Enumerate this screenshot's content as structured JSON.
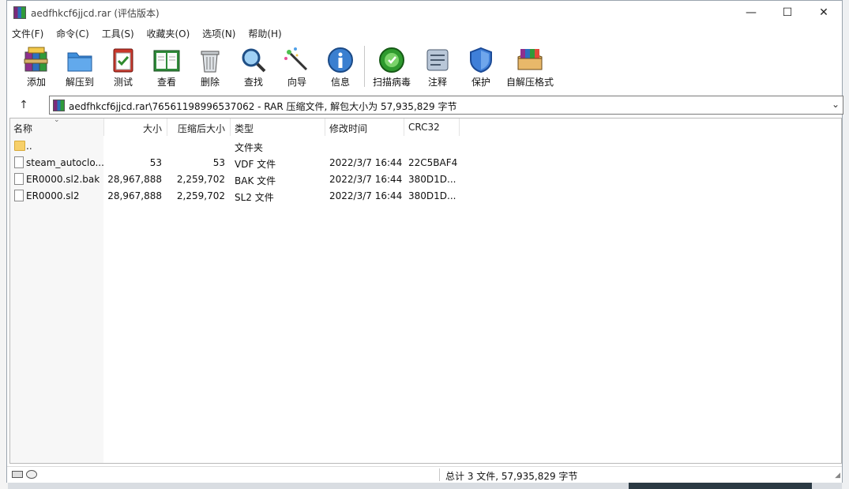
{
  "window": {
    "title": "aedfhkcf6jjcd.rar (评估版本)",
    "controls": {
      "minimize": "—",
      "maximize": "☐",
      "close": "✕"
    }
  },
  "menu": [
    "文件(F)",
    "命令(C)",
    "工具(S)",
    "收藏夹(O)",
    "选项(N)",
    "帮助(H)"
  ],
  "toolbar": [
    {
      "label": "添加",
      "icon": "add-archive-icon"
    },
    {
      "label": "解压到",
      "icon": "extract-folder-icon"
    },
    {
      "label": "测试",
      "icon": "test-clipboard-icon"
    },
    {
      "label": "查看",
      "icon": "view-book-icon"
    },
    {
      "label": "删除",
      "icon": "trash-icon"
    },
    {
      "label": "查找",
      "icon": "magnifier-icon"
    },
    {
      "label": "向导",
      "icon": "wizard-wand-icon"
    },
    {
      "label": "信息",
      "icon": "info-icon"
    },
    {
      "label": "扫描病毒",
      "icon": "virus-scan-icon"
    },
    {
      "label": "注释",
      "icon": "comment-icon"
    },
    {
      "label": "保护",
      "icon": "shield-icon"
    },
    {
      "label": "自解压格式",
      "icon": "sfx-box-icon"
    }
  ],
  "address": {
    "up_glyph": "↑",
    "path": "aedfhkcf6jjcd.rar\\76561198996537062 - RAR 压缩文件, 解包大小为 57,935,829 字节",
    "dropdown_glyph": "⌄"
  },
  "columns": {
    "name": "名称",
    "size": "大小",
    "packed": "压缩后大小",
    "type": "类型",
    "modified": "修改时间",
    "crc": "CRC32"
  },
  "files": [
    {
      "name": "..",
      "size": "",
      "packed": "",
      "type": "文件夹",
      "modified": "",
      "crc": "",
      "kind": "folder"
    },
    {
      "name": "steam_autoclo...",
      "size": "53",
      "packed": "53",
      "type": "VDF 文件",
      "modified": "2022/3/7 16:44",
      "crc": "22C5BAF4",
      "kind": "file"
    },
    {
      "name": "ER0000.sl2.bak",
      "size": "28,967,888",
      "packed": "2,259,702",
      "type": "BAK 文件",
      "modified": "2022/3/7 16:44",
      "crc": "380D1D...",
      "kind": "file"
    },
    {
      "name": "ER0000.sl2",
      "size": "28,967,888",
      "packed": "2,259,702",
      "type": "SL2 文件",
      "modified": "2022/3/7 16:44",
      "crc": "380D1D...",
      "kind": "file"
    }
  ],
  "status": {
    "summary": "总计 3 文件, 57,935,829 字节"
  }
}
